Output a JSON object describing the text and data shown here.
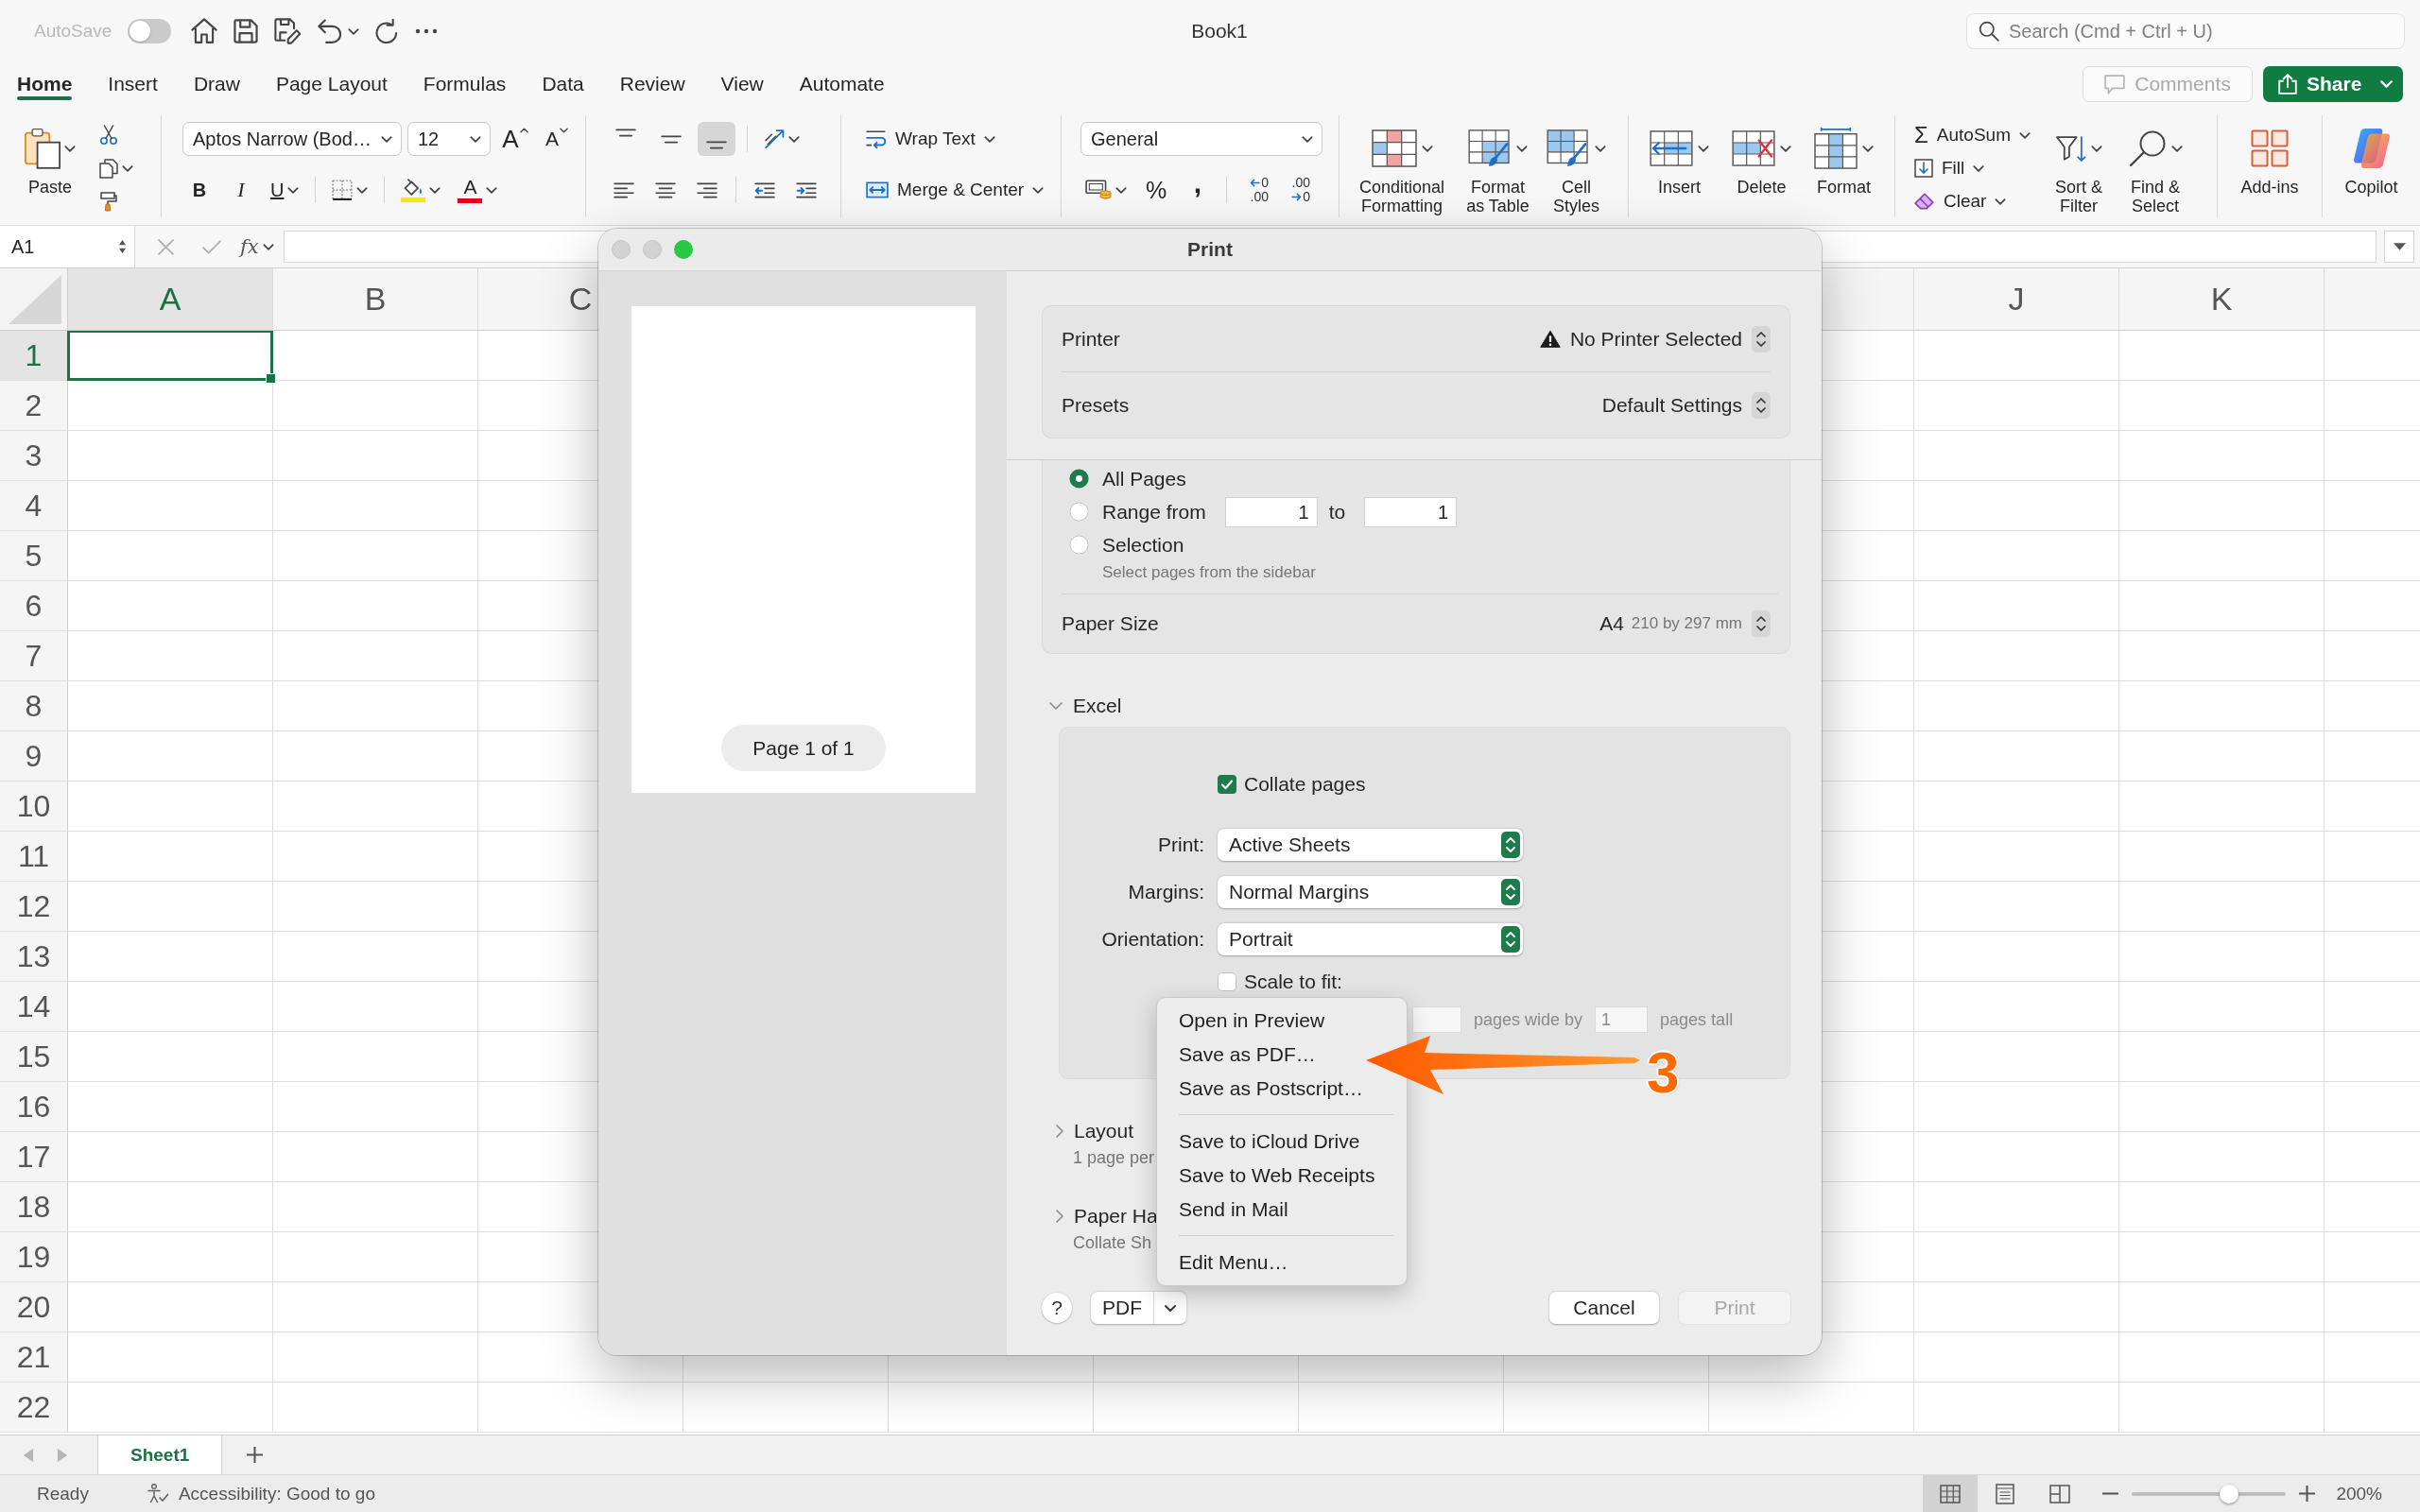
{
  "title_bar": {
    "autosave": {
      "label": "AutoSave",
      "on": false,
      "disabled": true
    },
    "title": "Book1",
    "search": {
      "placeholder": "Search (Cmd + Ctrl + U)"
    }
  },
  "ribbon_tabs": [
    {
      "label": "Home",
      "selected": true
    },
    {
      "label": "Insert",
      "selected": false
    },
    {
      "label": "Draw",
      "selected": false
    },
    {
      "label": "Page Layout",
      "selected": false
    },
    {
      "label": "Formulas",
      "selected": false
    },
    {
      "label": "Data",
      "selected": false
    },
    {
      "label": "Review",
      "selected": false
    },
    {
      "label": "View",
      "selected": false
    },
    {
      "label": "Automate",
      "selected": false
    }
  ],
  "comments_button": {
    "label": "Comments",
    "disabled": true
  },
  "share_button": {
    "label": "Share"
  },
  "ribbon": {
    "paste_label": "Paste",
    "font_name": "Aptos Narrow (Bod…",
    "font_size": "12",
    "font_size_buttons": [
      {
        "kind": "grow",
        "glyph": "A"
      },
      {
        "kind": "shrink",
        "glyph": "A"
      }
    ],
    "style_buttons": [
      {
        "kind": "bold",
        "glyph": "B"
      },
      {
        "kind": "italic",
        "glyph": "I"
      },
      {
        "kind": "underline",
        "glyph": "U"
      }
    ],
    "fill_color": {
      "color": "#ffe600"
    },
    "font_color": {
      "glyph": "A",
      "color": "#e3001b"
    },
    "vertical_align": [
      {
        "kind": "top",
        "selected": false
      },
      {
        "kind": "middle",
        "selected": false
      },
      {
        "kind": "bottom",
        "selected": true
      }
    ],
    "wrap_text": "Wrap Text",
    "merge_center": "Merge & Center",
    "number_format": "General",
    "percent_glyph": "%",
    "comma_glyph": ",",
    "decimal_buttons": [
      {
        "kind": "increase",
        "lines": [
          "0",
          ".00"
        ]
      },
      {
        "kind": "decrease",
        "lines": [
          ".00",
          "0"
        ]
      }
    ],
    "style_commands": [
      {
        "kind": "conditional_formatting",
        "label": "Conditional Formatting"
      },
      {
        "kind": "format_as_table",
        "label": "Format as Table"
      },
      {
        "kind": "cell_styles",
        "label": "Cell Styles"
      }
    ],
    "cell_commands": [
      {
        "kind": "insert",
        "label": "Insert"
      },
      {
        "kind": "delete",
        "label": "Delete"
      },
      {
        "kind": "format",
        "label": "Format"
      }
    ],
    "autosum": {
      "glyph": "Σ",
      "label": "AutoSum"
    },
    "fill_label": "Fill",
    "clear_label": "Clear",
    "editing_commands": [
      {
        "kind": "sort_filter",
        "label": "Sort & Filter"
      },
      {
        "kind": "find_select",
        "label": "Find & Select"
      }
    ],
    "addins_label": "Add-ins",
    "copilot_label": "Copilot"
  },
  "formula_bar": {
    "name_box": "A1",
    "function_glyph": "fx"
  },
  "sheet": {
    "columns_left": [
      {
        "label": "A",
        "selected": true
      },
      {
        "label": "B",
        "selected": false
      },
      {
        "label": "C",
        "selected": false
      }
    ],
    "columns_right": [
      {
        "selected": false
      },
      {
        "label": "J",
        "selected": false
      },
      {
        "label": "K",
        "selected": false
      }
    ],
    "rows": [
      {
        "label": "1",
        "selected": true
      },
      {
        "label": "2",
        "selected": false
      },
      {
        "label": "3",
        "selected": false
      },
      {
        "label": "4",
        "selected": false
      },
      {
        "label": "5",
        "selected": false
      },
      {
        "label": "6",
        "selected": false
      },
      {
        "label": "7",
        "selected": false
      },
      {
        "label": "8",
        "selected": false
      },
      {
        "label": "9",
        "selected": false
      },
      {
        "label": "10",
        "selected": false
      },
      {
        "label": "11",
        "selected": false
      },
      {
        "label": "12",
        "selected": false
      },
      {
        "label": "13",
        "selected": false
      },
      {
        "label": "14",
        "selected": false
      },
      {
        "label": "15",
        "selected": false
      },
      {
        "label": "16",
        "selected": false
      },
      {
        "label": "17",
        "selected": false
      },
      {
        "label": "18",
        "selected": false
      },
      {
        "label": "19",
        "selected": false
      },
      {
        "label": "20",
        "selected": false
      },
      {
        "label": "21",
        "selected": false
      },
      {
        "label": "22",
        "selected": false
      }
    ]
  },
  "sheet_tabs": [
    {
      "label": "Sheet1",
      "selected": true
    }
  ],
  "status_bar": {
    "status": "Ready",
    "accessibility": "Accessibility: Good to go",
    "views": [
      {
        "kind": "normal",
        "selected": true
      },
      {
        "kind": "page_layout",
        "selected": false
      },
      {
        "kind": "page_break",
        "selected": false
      }
    ],
    "zoom": {
      "level": 0.63,
      "reading": "200%"
    }
  },
  "print_dialog": {
    "title": "Print",
    "traffic_lights": [
      {
        "kind": "close",
        "enabled": false
      },
      {
        "kind": "minimize",
        "enabled": false
      },
      {
        "kind": "zoom",
        "enabled": true
      }
    ],
    "preview": {
      "page_label": "Page 1 of 1"
    },
    "printer": {
      "label": "Printer",
      "value": "No Printer Selected",
      "warning": true
    },
    "presets": {
      "label": "Presets",
      "value": "Default Settings"
    },
    "pages": [
      {
        "kind": "all",
        "label": "All Pages",
        "selected": true
      },
      {
        "kind": "range",
        "label": "Range from",
        "selected": false,
        "from": "1",
        "to_label": "to",
        "to": "1"
      },
      {
        "kind": "selection",
        "label": "Selection",
        "selected": false,
        "hint": "Select pages from the sidebar"
      }
    ],
    "paper_size": {
      "label": "Paper Size",
      "value": "A4",
      "detail": "210 by 297 mm"
    },
    "excel": {
      "title": "Excel",
      "expanded": true,
      "collate": {
        "label": "Collate pages",
        "checked": true
      },
      "popups": [
        {
          "label": "Print:",
          "value": "Active Sheets"
        },
        {
          "label": "Margins:",
          "value": "Normal Margins"
        },
        {
          "label": "Orientation:",
          "value": "Portrait"
        }
      ],
      "scale_to_fit": {
        "label": "Scale to fit:",
        "checked": false
      },
      "fit": {
        "disabled": true,
        "wide_label": "pages wide by",
        "tall_value": "1",
        "tall_label": "pages tall"
      }
    },
    "sections": [
      {
        "title": "Layout",
        "summary": "1 page per",
        "expanded": false
      },
      {
        "title": "Paper Ha",
        "summary": "Collate Sh",
        "expanded": false
      }
    ],
    "help_button": "?",
    "pdf_button": "PDF",
    "pdf_menu": [
      {
        "kind": "item",
        "label": "Open in Preview"
      },
      {
        "kind": "item",
        "label": "Save as PDF…"
      },
      {
        "kind": "item",
        "label": "Save as Postscript…"
      },
      {
        "kind": "separator"
      },
      {
        "kind": "item",
        "label": "Save to iCloud Drive"
      },
      {
        "kind": "item",
        "label": "Save to Web Receipts"
      },
      {
        "kind": "item",
        "label": "Send in Mail"
      },
      {
        "kind": "separator"
      },
      {
        "kind": "item",
        "label": "Edit Menu…"
      }
    ],
    "buttons": [
      {
        "label": "Cancel",
        "disabled": false
      },
      {
        "label": "Print",
        "disabled": true
      }
    ]
  },
  "annotation": {
    "kind": "arrow",
    "label": "3"
  }
}
